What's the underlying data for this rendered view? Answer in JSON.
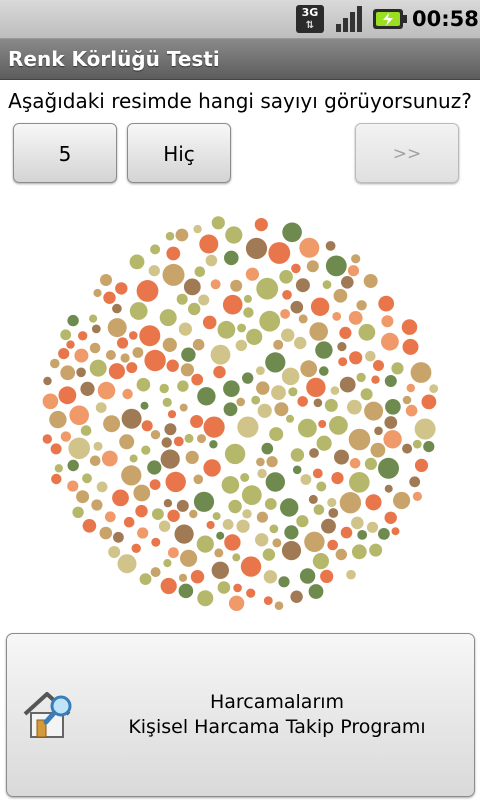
{
  "status_bar": {
    "network": "3G",
    "time": "00:58",
    "icons": [
      "3g-data-icon",
      "signal-strength-icon",
      "battery-charging-icon"
    ]
  },
  "app": {
    "title": "Renk Körlüğü Testi"
  },
  "question": "Aşağıdaki resimde hangi sayıyı görüyorsunuz?",
  "answers": [
    {
      "label": "5"
    },
    {
      "label": "Hiç"
    }
  ],
  "next": {
    "label": ">>",
    "enabled": false
  },
  "plate": {
    "colors": {
      "orange": "#e8764a",
      "light_orange": "#f09a6a",
      "tan": "#c9a46a",
      "brown": "#a07a54",
      "olive": "#b5b86a",
      "green": "#6e8a4e",
      "khaki": "#d1c48a"
    }
  },
  "ad": {
    "line1": "Harcamalarım",
    "line2": "Kişisel Harcama Takip Programı",
    "icon": "house-search-icon"
  }
}
